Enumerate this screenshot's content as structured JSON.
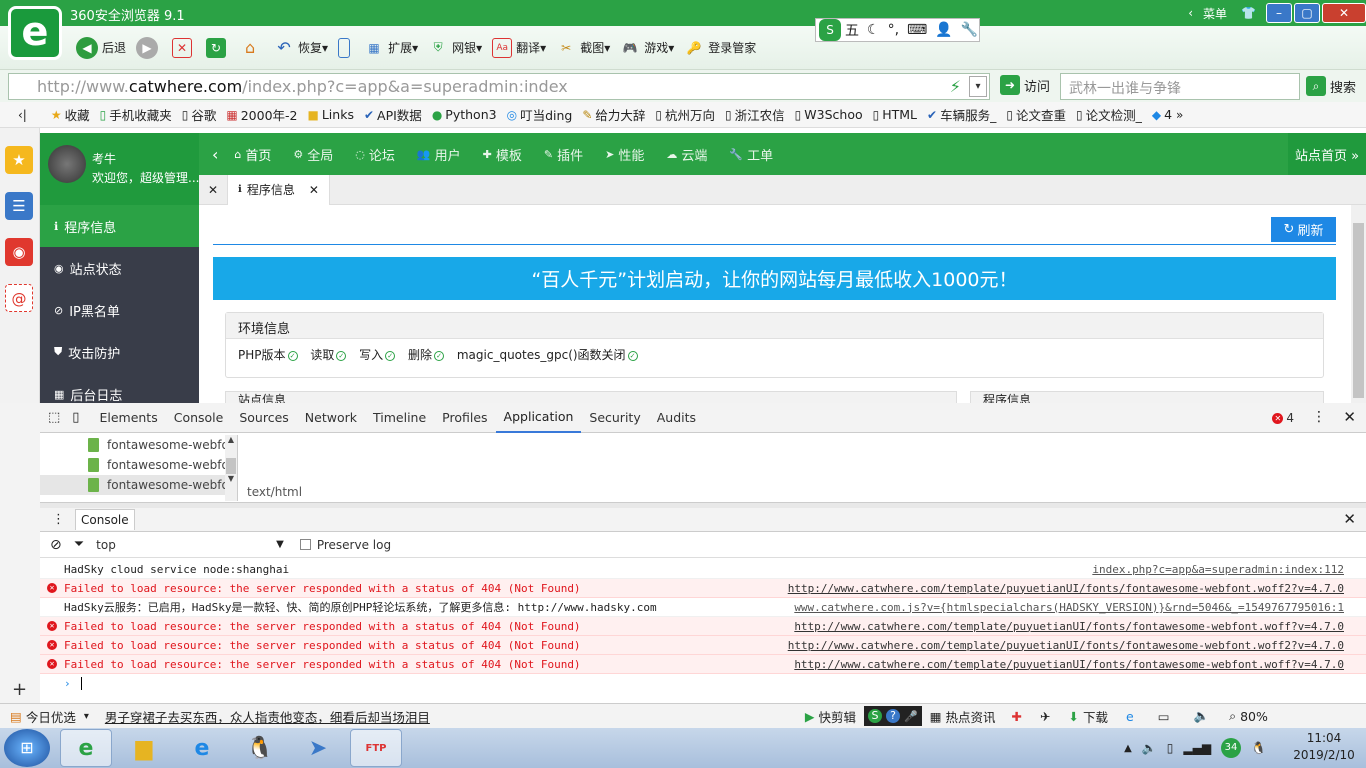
{
  "browser": {
    "title": "360安全浏览器 9.1",
    "logo_glyph": "e",
    "menu_label": "菜单",
    "toolbar": {
      "back": "后退",
      "restore": "恢复",
      "extensions": "扩展",
      "netbank": "网银",
      "translate": "翻译",
      "screenshot": "截图",
      "games": "游戏",
      "login_manager": "登录管家"
    },
    "ime": {
      "mode": "五",
      "glyph": "S"
    },
    "address": {
      "prefix": "http://www.",
      "domain": "catwhere.com",
      "path": "/index.php?c=app&a=superadmin:index",
      "visit_label": "访问",
      "search_placeholder": "武林一出谁与争锋",
      "search_button": "搜索"
    },
    "bookmarks": [
      "收藏",
      "手机收藏夹",
      "谷歌",
      "2000年-2",
      "Links",
      "API数据",
      "Python3",
      "叮当ding",
      "给力大辞",
      "杭州万向",
      "浙江农信",
      "W3Schoo",
      "HTML",
      "车辆服务_",
      "论文查重",
      "论文检测_",
      "4"
    ]
  },
  "admin": {
    "username": "考牛",
    "welcome": "欢迎您，超级管理...",
    "nav": [
      "首页",
      "全局",
      "论坛",
      "用户",
      "模板",
      "插件",
      "性能",
      "云端",
      "工单"
    ],
    "site_home": "站点首页 »",
    "left_menu": [
      "程序信息",
      "站点状态",
      "IP黑名单",
      "攻击防护",
      "后台日志"
    ],
    "tab_label": "程序信息",
    "refresh_label": "刷新",
    "banner_text": "“百人千元”计划启动，让你的网站每月最低收入1000元！",
    "env_title": "环境信息",
    "env_items": [
      "PHP版本",
      "读取",
      "写入",
      "删除",
      "magic_quotes_gpc()函数关闭"
    ],
    "panel_left_title": "站点信息",
    "panel_right_title": "程序信息"
  },
  "devtools": {
    "tabs": [
      "Elements",
      "Console",
      "Sources",
      "Network",
      "Timeline",
      "Profiles",
      "Application",
      "Security",
      "Audits"
    ],
    "active_tab": "Application",
    "error_count": "4",
    "tree_items": [
      "fontawesome-webfon",
      "fontawesome-webfon",
      "fontawesome-webfon"
    ],
    "mime": "text/html",
    "console_tab": "Console",
    "context": "top",
    "preserve_log": "Preserve log",
    "messages": [
      {
        "type": "log",
        "text": "HadSky cloud service node:shanghai",
        "source": "index.php?c=app&a=superadmin:index:112"
      },
      {
        "type": "error",
        "text": "Failed to load resource: the server responded with a status of 404 (Not Found)",
        "source": "http://www.catwhere.com/template/puyuetianUI/fonts/fontawesome-webfont.woff2?v=4.7.0"
      },
      {
        "type": "log",
        "text": "HadSky云服务：已启用，HadSky是一款轻、快、简的原创PHP轻论坛系统，了解更多信息: http://www.hadsky.com",
        "source": "www.catwhere.com.js?v={htmlspecialchars(HADSKY_VERSION)}&rnd=5046&_=1549767795016:1"
      },
      {
        "type": "error",
        "text": "Failed to load resource: the server responded with a status of 404 (Not Found)",
        "source": "http://www.catwhere.com/template/puyuetianUI/fonts/fontawesome-webfont.woff?v=4.7.0"
      },
      {
        "type": "error",
        "text": "Failed to load resource: the server responded with a status of 404 (Not Found)",
        "source": "http://www.catwhere.com/template/puyuetianUI/fonts/fontawesome-webfont.woff2?v=4.7.0"
      },
      {
        "type": "error",
        "text": "Failed to load resource: the server responded with a status of 404 (Not Found)",
        "source": "http://www.catwhere.com/template/puyuetianUI/fonts/fontawesome-webfont.woff?v=4.7.0"
      }
    ]
  },
  "statusbar": {
    "today": "今日优选",
    "headline": "男子穿裙子去买东西，众人指责他变态，细看后却当场泪目",
    "quick_cut": "快剪辑",
    "hot_news": "热点资讯",
    "download": "下载",
    "zoom": "80%"
  },
  "taskbar": {
    "time": "11:04",
    "date": "2019/2/10",
    "badge": "34",
    "ftp_label": "FTP"
  },
  "colors": {
    "green": "#2ba245",
    "dark_menu": "#393d49",
    "blue": "#1e88e5",
    "banner": "#18a8e8",
    "error": "#e0161d"
  }
}
